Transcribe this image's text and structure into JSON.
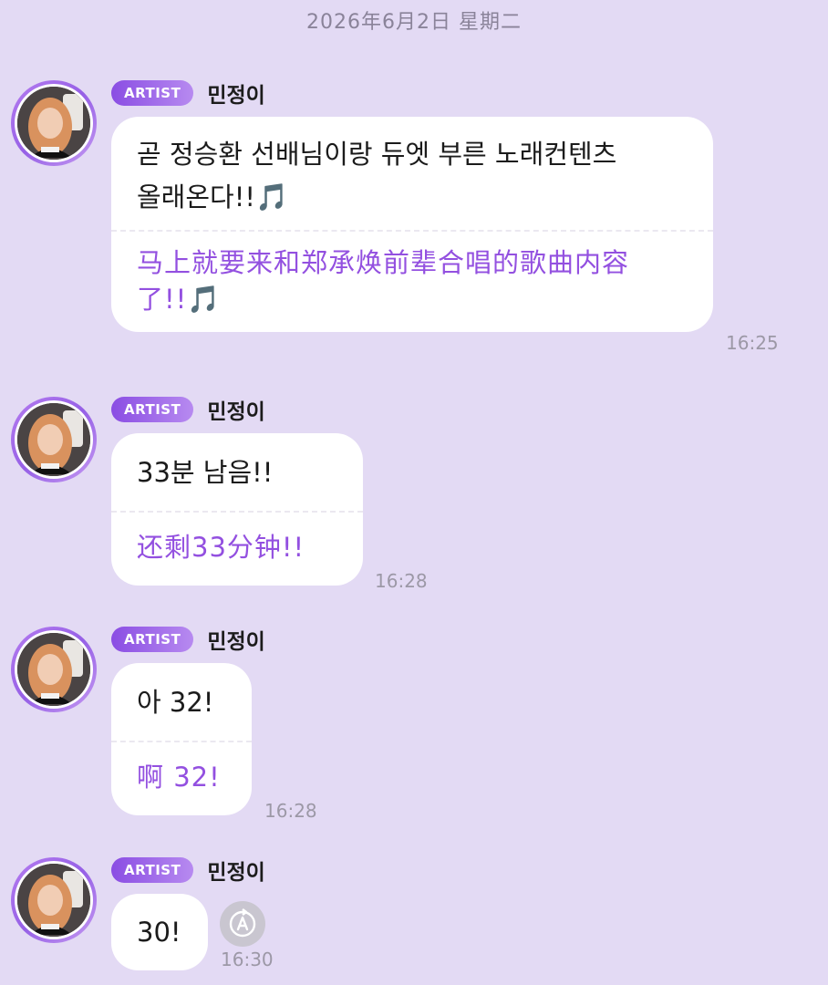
{
  "date_header": "2026年6月2日 星期二",
  "badge_label": "ARTIST",
  "sender_name": "민정이",
  "messages": [
    {
      "ko_lines": [
        "곧 정승환 선배님이랑 듀엣 부른 노래컨텐츠",
        "올래온다!!🎵"
      ],
      "zh_lines": [
        "马上就要来和郑承焕前辈合唱的歌曲内容",
        "了!!🎵"
      ],
      "time": "16:25"
    },
    {
      "ko_lines": [
        "33분 남음!!"
      ],
      "zh_lines": [
        "还剩33分钟!!"
      ],
      "time": "16:28"
    },
    {
      "ko_lines": [
        "아 32!"
      ],
      "zh_lines": [
        "啊 32!"
      ],
      "time": "16:28"
    },
    {
      "ko_lines": [
        "30!"
      ],
      "zh_lines": [],
      "time": "16:30",
      "translate_icon": "translate-icon"
    }
  ],
  "colors": {
    "background": "#e3daf4",
    "translation_text": "#9350e0",
    "badge_start": "#8a4de3",
    "badge_end": "#b78af0"
  }
}
